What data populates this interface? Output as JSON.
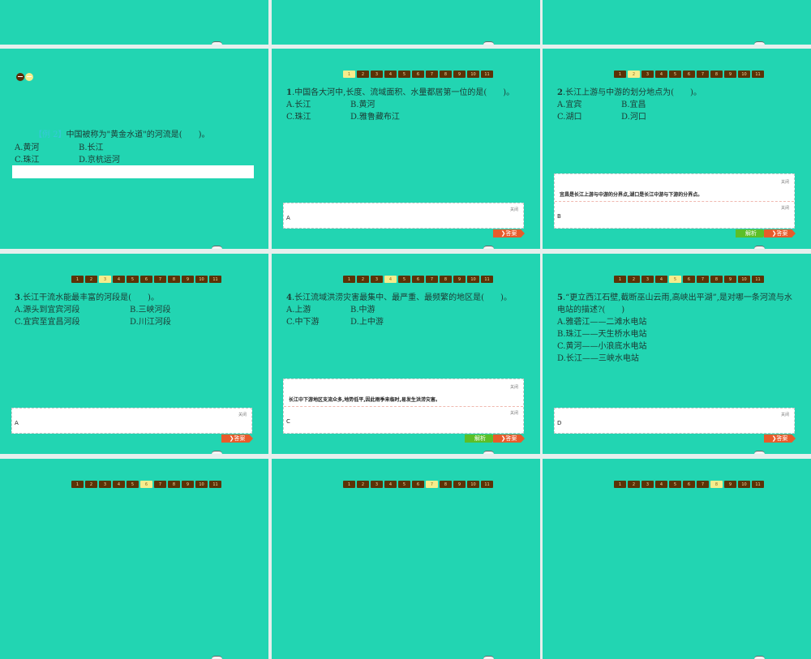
{
  "colors": {
    "slide_bg": "#22d5b2",
    "nav_bg": "#5c3206",
    "nav_current": "#f6ec8c",
    "answer_btn": "#e85b2b",
    "explain_btn": "#5cbf28"
  },
  "nav_pages": [
    "1",
    "2",
    "3",
    "4",
    "5",
    "6",
    "7",
    "8",
    "9",
    "10",
    "11"
  ],
  "labels": {
    "close": "关闭",
    "answer": "❯答案",
    "explain": "解析"
  },
  "example": {
    "tag": "【例 2】",
    "text": "中国被称为\"黄金水道\"的河流是(　　)。",
    "options": [
      "A.黄河",
      "B.长江",
      "C.珠江",
      "D.京杭运河"
    ]
  },
  "questions": [
    {
      "current": 1,
      "num": "1",
      "text": ".中国各大河中,长度、流域面积、水量都居第一位的是(　　)。",
      "options": [
        "A.长江",
        "B.黄河",
        "C.珠江",
        "D.雅鲁藏布江"
      ],
      "answer": "A",
      "explanation": null
    },
    {
      "current": 2,
      "num": "2",
      "text": ".长江上游与中游的划分地点为(　　)。",
      "options": [
        "A.宜宾",
        "B.宜昌",
        "C.湖口",
        "D.河口"
      ],
      "answer": "B",
      "explanation": "宜昌是长江上游与中游的分界点,湖口是长江中游与下游的分界点。"
    },
    {
      "current": 3,
      "num": "3",
      "text": ".长江干流水能最丰富的河段是(　　)。",
      "options": [
        "A.源头到宜宾河段",
        "B.三峡河段",
        "C.宜宾至宜昌河段",
        "D.川江河段"
      ],
      "answer": "A",
      "explanation": null
    },
    {
      "current": 4,
      "num": "4",
      "text": ".长江流域洪涝灾害最集中、最严重、最频繁的地区是(　　)。",
      "options": [
        "A.上游",
        "B.中游",
        "C.中下游",
        "D.上中游"
      ],
      "answer": "C",
      "explanation": "长江中下游地区支流众多,地势低平,因此雨季来临时,易发生洪涝灾害。"
    },
    {
      "current": 5,
      "num": "5",
      "text": ".“更立西江石壁,截断巫山云雨,高峡出平湖”,是对哪一条河流与水电站的描述?(　　)",
      "options": [
        "A.雅砻江——二滩水电站",
        "B.珠江——天生桥水电站",
        "C.黄河——小浪底水电站",
        "D.长江——三峡水电站"
      ],
      "answer": "D",
      "explanation": null
    }
  ],
  "partial_slides": [
    {
      "current": 6
    },
    {
      "current": 7
    },
    {
      "current": 8
    }
  ]
}
